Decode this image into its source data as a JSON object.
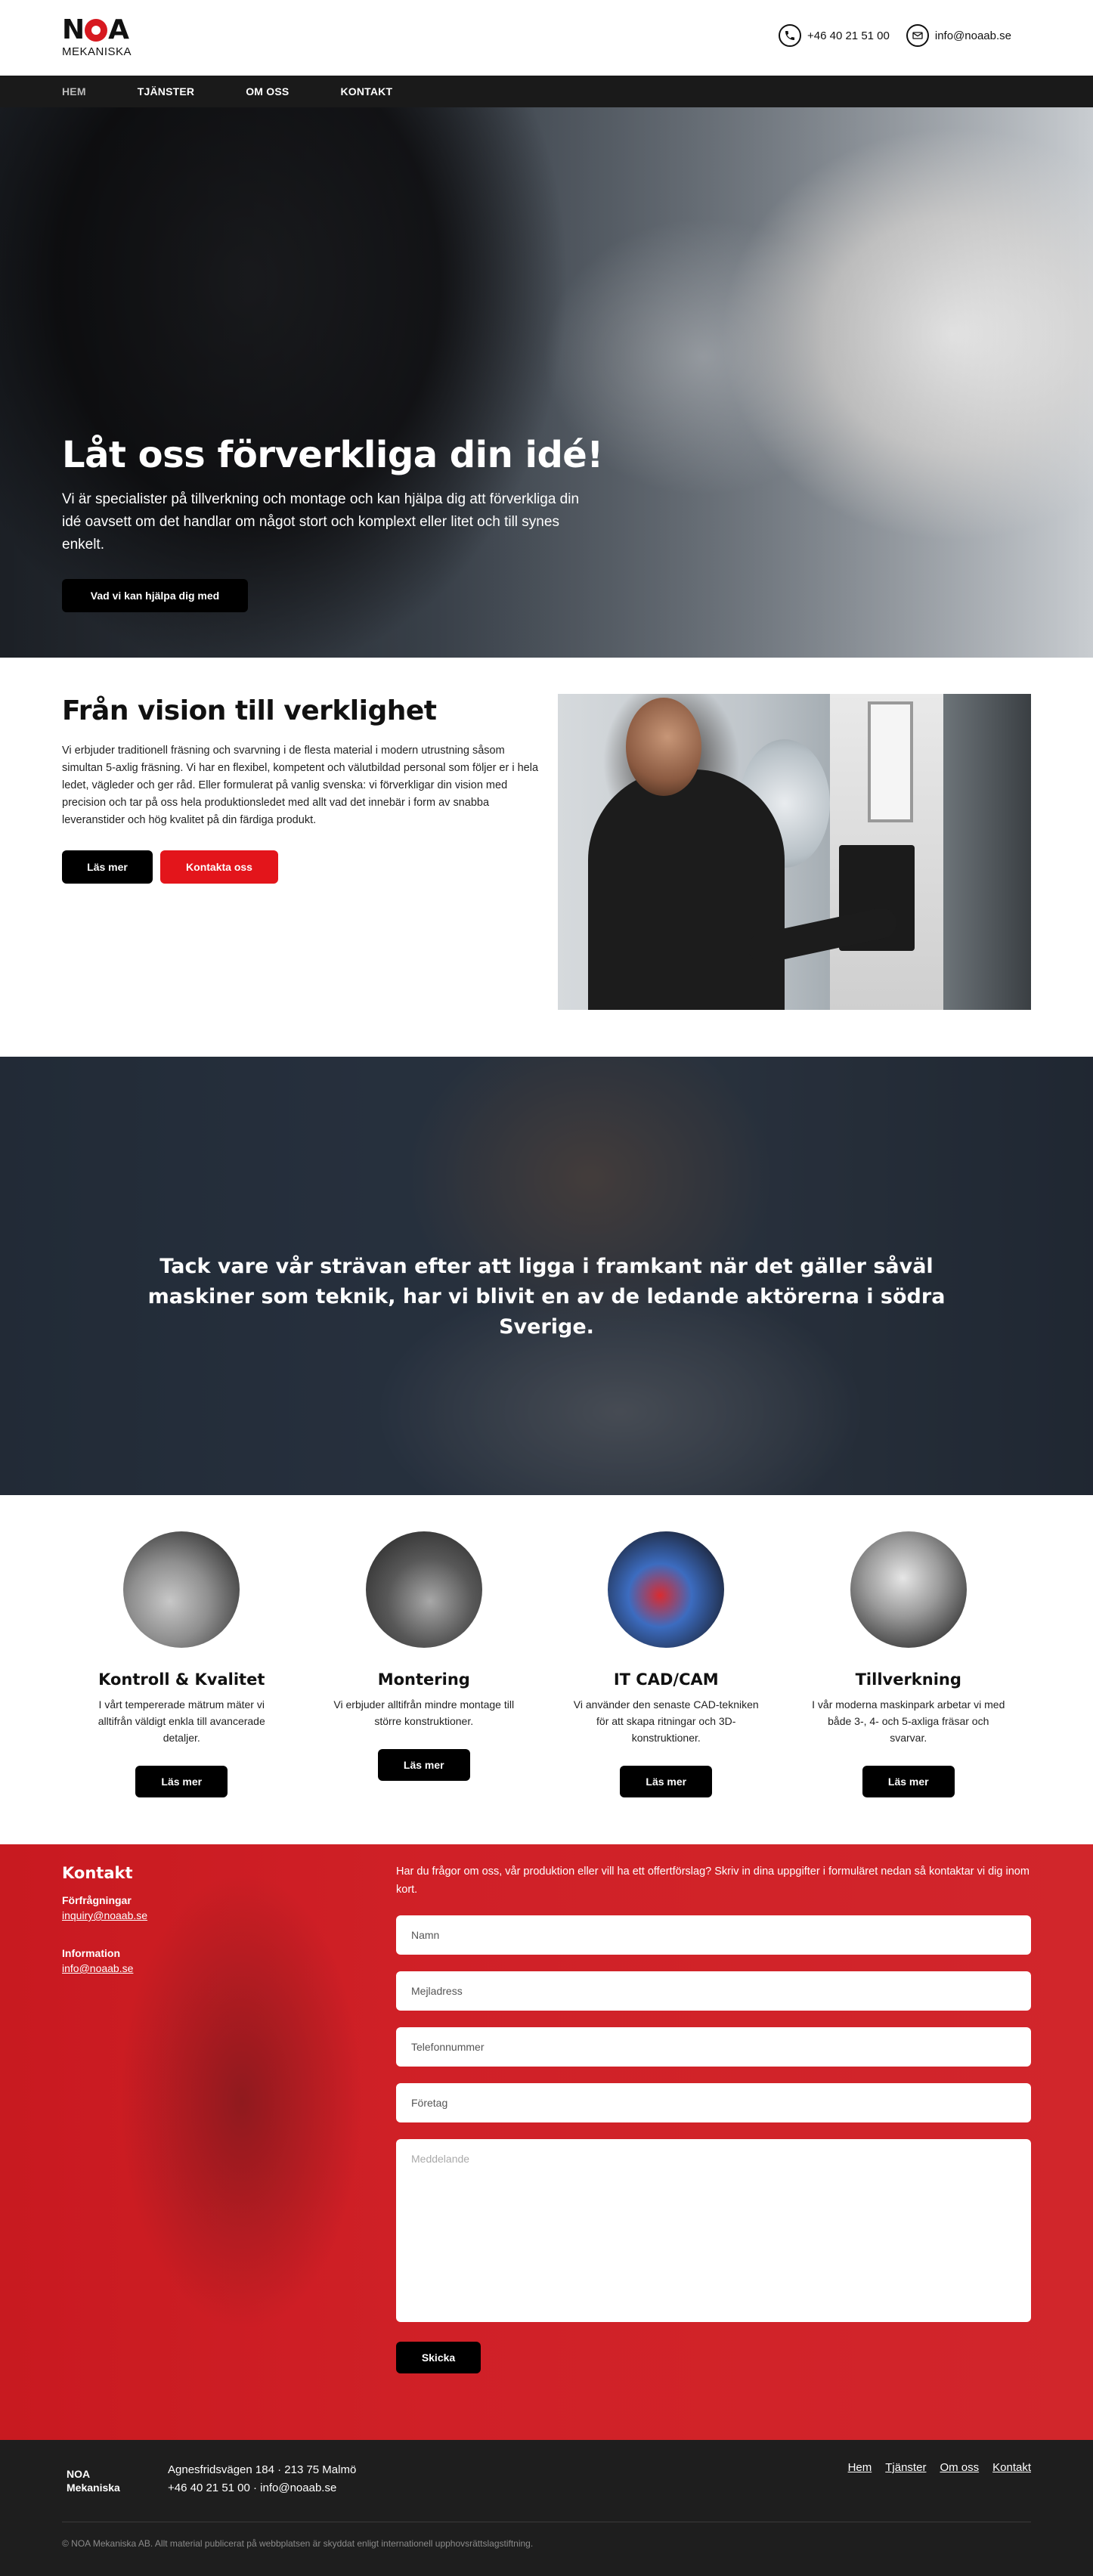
{
  "header": {
    "logo_main": "NOA",
    "logo_sub": "MEKANISKA",
    "phone": "+46 40 21 51 00",
    "email": "info@noaab.se"
  },
  "nav": {
    "items": [
      {
        "label": "HEM"
      },
      {
        "label": "TJÄNSTER"
      },
      {
        "label": "OM OSS"
      },
      {
        "label": "KONTAKT"
      }
    ]
  },
  "hero": {
    "title": "Låt oss förverkliga din idé!",
    "text": "Vi är specialister på tillverkning och montage och kan hjälpa dig att förverkliga din idé oavsett om det handlar om något stort och komplext eller litet och till synes enkelt.",
    "button": "Vad vi kan hjälpa dig med"
  },
  "vision": {
    "title": "Från vision till verklighet",
    "text": "Vi erbjuder traditionell fräsning och svarvning i de flesta material i modern utrustning såsom simultan 5-axlig fräsning. Vi har en flexibel, kompetent och välutbildad personal som följer er i hela ledet, vägleder och ger råd. Eller formulerat på vanlig svenska: vi förverkligar din vision med precision och tar på oss hela produktionsledet med allt vad det innebär i form av snabba leveranstider och hög kvalitet på din färdiga produkt.",
    "read_more": "Läs mer",
    "contact": "Kontakta oss"
  },
  "banner": {
    "quote": "Tack vare vår strävan efter att ligga i framkant när det gäller såväl maskiner som teknik, har vi blivit en av de ledande aktörerna i södra Sverige."
  },
  "services": [
    {
      "title": "Kontroll & Kvalitet",
      "text": "I vårt tempererade mätrum mäter vi alltifrån väldigt enkla till avancerade detaljer.",
      "button": "Läs mer"
    },
    {
      "title": "Montering",
      "text": "Vi erbjuder alltifrån mindre montage till större konstruktioner.",
      "button": "Läs mer"
    },
    {
      "title": "IT CAD/CAM",
      "text": "Vi använder den senaste CAD-tekniken för att skapa ritningar och 3D-konstruktioner.",
      "button": "Läs mer"
    },
    {
      "title": "Tillverkning",
      "text": "I vår moderna maskinpark arbetar vi med både 3-, 4- och 5-axliga fräsar och svarvar.",
      "button": "Läs mer"
    }
  ],
  "contact": {
    "title": "Kontakt",
    "inquiries_label": "Förfrågningar",
    "inquiries_email": "inquiry@noaab.se",
    "info_label": "Information",
    "info_email": "info@noaab.se",
    "intro": "Har du frågor om oss, vår produktion eller vill ha ett offertförslag? Skriv in dina uppgifter i formuläret nedan så kontaktar vi dig inom kort.",
    "placeholders": {
      "name": "Namn",
      "email": "Mejladress",
      "phone": "Telefonnummer",
      "company": "Företag",
      "message": "Meddelande"
    },
    "submit": "Skicka"
  },
  "footer": {
    "logo_line1": "NOA",
    "logo_line2": "Mekaniska",
    "address": "Agnesfridsvägen 184 · 213 75 Malmö",
    "contact_line": "+46 40 21 51 00 · info@noaab.se",
    "links": [
      "Hem",
      "Tjänster",
      "Om oss",
      "Kontakt"
    ],
    "copyright": "© NOA Mekaniska AB. Allt material publicerat på webbplatsen är skyddat enligt internationell upphovsrättslagstiftning."
  }
}
